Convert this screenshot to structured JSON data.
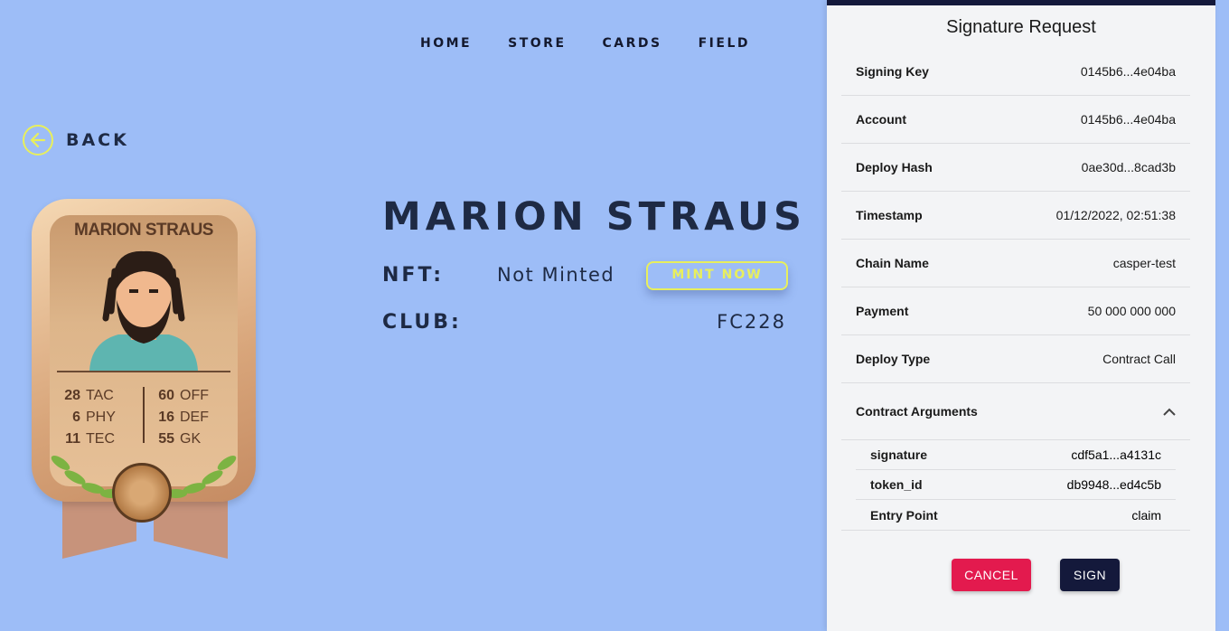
{
  "nav": [
    "HOME",
    "STORE",
    "CARDS",
    "FIELD"
  ],
  "back_label": "BACK",
  "card": {
    "name": "MARION STRAUS",
    "stats_left": [
      {
        "value": "28",
        "label": "TAC"
      },
      {
        "value": "6",
        "label": "PHY"
      },
      {
        "value": "11",
        "label": "TEC"
      }
    ],
    "stats_right": [
      {
        "value": "60",
        "label": "OFF"
      },
      {
        "value": "16",
        "label": "DEF"
      },
      {
        "value": "55",
        "label": "GK"
      }
    ]
  },
  "player": {
    "name": "MARION STRAUS",
    "nft_label": "NFT:",
    "nft_status": "Not Minted",
    "mint_button": "MINT NOW",
    "club_label": "CLUB:",
    "club_value": "FC228"
  },
  "signature": {
    "title": "Signature Request",
    "rows": [
      {
        "key": "Signing Key",
        "value": "0145b6...4e04ba"
      },
      {
        "key": "Account",
        "value": "0145b6...4e04ba"
      },
      {
        "key": "Deploy Hash",
        "value": "0ae30d...8cad3b"
      },
      {
        "key": "Timestamp",
        "value": "01/12/2022, 02:51:38"
      },
      {
        "key": "Chain Name",
        "value": "casper-test"
      },
      {
        "key": "Payment",
        "value": "50 000 000 000"
      },
      {
        "key": "Deploy Type",
        "value": "Contract Call"
      }
    ],
    "arguments_label": "Contract Arguments",
    "arguments": [
      {
        "key": "signature",
        "value": "cdf5a1...a4131c"
      },
      {
        "key": "token_id",
        "value": "db9948...ed4c5b"
      },
      {
        "key": "Entry Point",
        "value": "claim"
      }
    ],
    "cancel_label": "CANCEL",
    "sign_label": "SIGN"
  },
  "colors": {
    "background": "#9dbdf7",
    "accent": "#e8ef5c",
    "cancel": "#e31a4e",
    "sign": "#14193b"
  }
}
